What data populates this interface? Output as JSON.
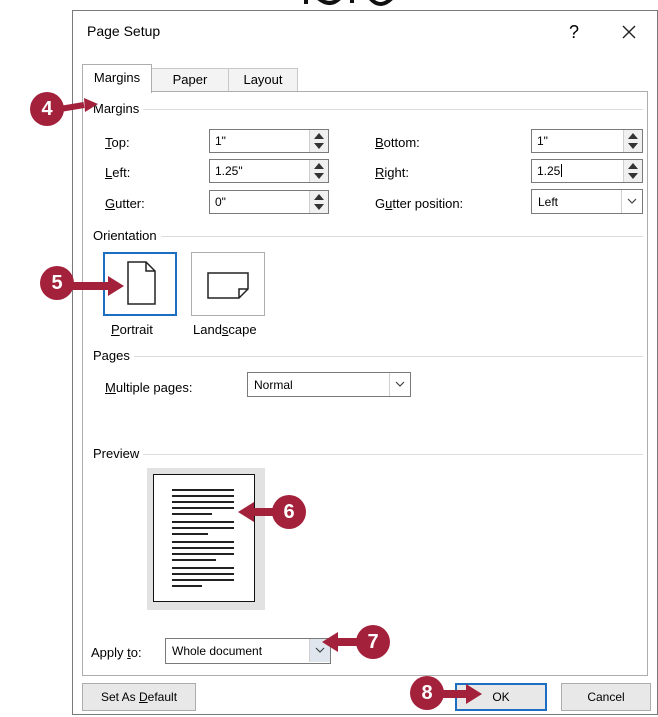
{
  "dialog": {
    "title": "Page Setup",
    "help": "?",
    "close": "✕"
  },
  "tabs": [
    {
      "label": "Margins",
      "active": true
    },
    {
      "label": "Paper",
      "active": false
    },
    {
      "label": "Layout",
      "active": false
    }
  ],
  "margins": {
    "section_label": "Margins",
    "top": {
      "label": "Top:",
      "mnemonic": "T",
      "rest": "op:",
      "value": "1\""
    },
    "bottom": {
      "label": "Bottom:",
      "mnemonic": "B",
      "rest": "ottom:",
      "value": "1\""
    },
    "left": {
      "label": "Left:",
      "mnemonic": "L",
      "rest": "eft:",
      "value": "1.25\""
    },
    "right": {
      "label": "Right:",
      "mnemonic": "R",
      "rest": "ight:",
      "value": "1.25"
    },
    "gutter": {
      "label": "Gutter:",
      "mnemonic": "G",
      "rest": "utter:",
      "value": "0\""
    },
    "gutter_position": {
      "label": "Gutter position:",
      "pre": "G",
      "mnemonic": "u",
      "rest": "tter position:",
      "value": "Left"
    }
  },
  "orientation": {
    "section_label": "Orientation",
    "portrait": {
      "label": "Portrait",
      "mnemonic": "P",
      "rest": "ortrait",
      "selected": true
    },
    "landscape": {
      "label": "Landscape",
      "pre": "Land",
      "mnemonic": "s",
      "rest": "cape",
      "selected": false
    }
  },
  "pages": {
    "section_label": "Pages",
    "multiple_pages": {
      "label": "Multiple pages:",
      "mnemonic": "M",
      "rest": "ultiple pages:",
      "value": "Normal"
    }
  },
  "preview": {
    "section_label": "Preview",
    "apply_to": {
      "label": "Apply to:",
      "pre": "Apply ",
      "mnemonic": "t",
      "rest": "o:",
      "value": "Whole document"
    }
  },
  "buttons": {
    "set_default": {
      "pre": "Set As ",
      "mnemonic": "D",
      "rest": "efault"
    },
    "ok": "OK",
    "cancel": "Cancel"
  },
  "callouts": [
    "4",
    "5",
    "6",
    "7",
    "8"
  ],
  "callout_color": "#a3213b",
  "selection_color": "#1b6ec2"
}
